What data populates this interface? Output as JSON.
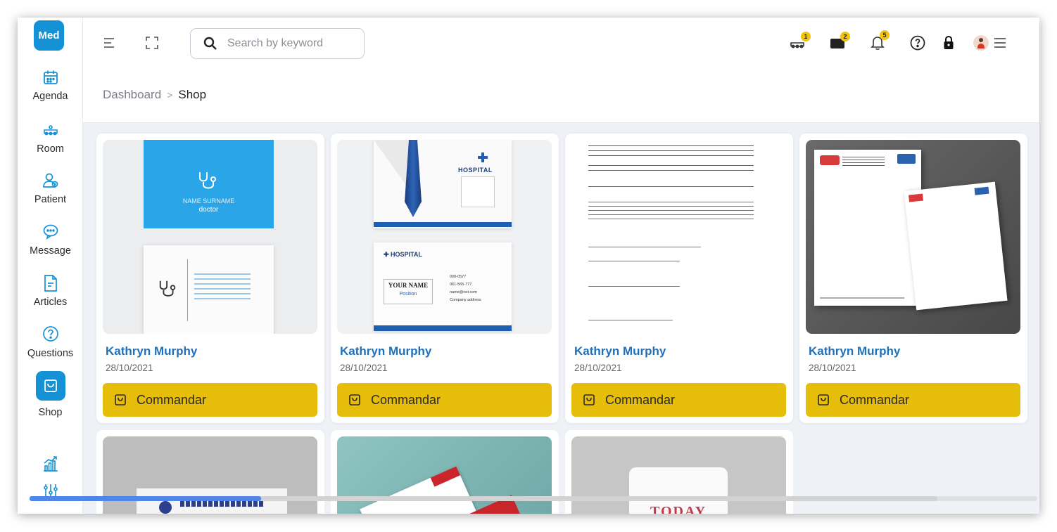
{
  "app": {
    "logo_text": "Med",
    "brand_color": "#1592d6",
    "accent_color": "#e6bd0b"
  },
  "sidebar": {
    "items": [
      {
        "label": "Agenda",
        "icon": "calendar-icon"
      },
      {
        "label": "Room",
        "icon": "bed-icon"
      },
      {
        "label": "Patient",
        "icon": "patient-icon"
      },
      {
        "label": "Message",
        "icon": "chat-icon"
      },
      {
        "label": "Articles",
        "icon": "document-icon"
      },
      {
        "label": "Questions",
        "icon": "question-icon"
      },
      {
        "label": "Shop",
        "icon": "shopping-bag-icon",
        "active": true
      },
      {
        "label": "",
        "icon": "chart-icon"
      },
      {
        "label": "",
        "icon": "sliders-icon"
      }
    ]
  },
  "header": {
    "search_placeholder": "Search by keyword",
    "badges": {
      "room": "1",
      "messages": "2",
      "notifications": "5"
    }
  },
  "breadcrumb": {
    "home": "Dashboard",
    "separator": ">",
    "current": "Shop"
  },
  "products": [
    {
      "name": "Kathryn Murphy",
      "date": "28/10/2021",
      "button": "Commandar",
      "thumbnail": "business-card-doctor-blue"
    },
    {
      "name": "Kathryn Murphy",
      "date": "28/10/2021",
      "button": "Commandar",
      "thumbnail": "hospital-id-card"
    },
    {
      "name": "Kathryn Murphy",
      "date": "28/10/2021",
      "button": "Commandar",
      "thumbnail": "medical-certificate"
    },
    {
      "name": "Kathryn Murphy",
      "date": "28/10/2021",
      "button": "Commandar",
      "thumbnail": "letterhead-paper"
    }
  ],
  "products_row2": [
    {
      "thumbnail": "arabic-business-card"
    },
    {
      "thumbnail": "red-business-cards"
    },
    {
      "thumbnail": "mug-today"
    }
  ],
  "thumb_text": {
    "card1_line1": "NAME SURNAME",
    "card1_line2": "doctor",
    "card2_hospital": "HOSPITAL",
    "card2_your_name": "YOUR NAME",
    "card2_position": "Position",
    "card2_phone1": "000-0577",
    "card2_phone2": "061-565-777",
    "card2_email": "name@net.com",
    "card2_address": "Company address",
    "mug_text": "TODAY"
  },
  "video": {
    "progress": 0.23
  }
}
